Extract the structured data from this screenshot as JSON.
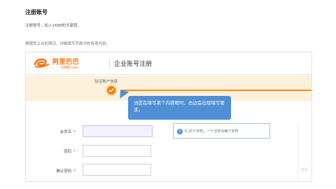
{
  "page": {
    "title": "注册账号",
    "subtitle": "注册账号，加入1688的大家庭。",
    "instruction": "根据您企业的情况，详细填写页面中的各项内容。"
  },
  "header": {
    "logo_cn": "阿里巴巴",
    "logo_domain": "1688.com",
    "title": "企业账号注册"
  },
  "steps": {
    "current_label": "验证账户信息",
    "current_icon": "check-icon"
  },
  "tooltip": {
    "text": "当您在填写某个内容框时，右边会出现填写要求。"
  },
  "form": {
    "fields": [
      {
        "label": "会员名",
        "required": "*",
        "value": "",
        "hint": "5-25个字符，一个汉字为两个字符"
      },
      {
        "label": "密码",
        "required": "*",
        "value": ""
      },
      {
        "label": "确认密码",
        "required": "*",
        "value": ""
      }
    ]
  },
  "side_panel": {
    "text": "企业"
  },
  "colors": {
    "brand": "#ff6a00",
    "step_bg": "#fdf1dc",
    "tooltip_bg": "#4f8fd6",
    "required": "#e4393c"
  }
}
